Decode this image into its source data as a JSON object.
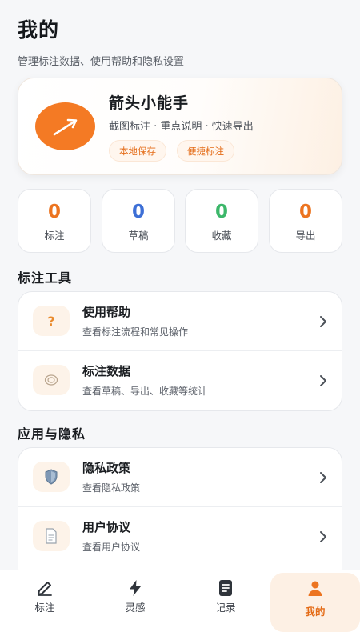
{
  "header": {
    "title": "我的",
    "subtitle": "管理标注数据、使用帮助和隐私设置"
  },
  "profile": {
    "app_name": "箭头小能手",
    "tagline": "截图标注 · 重点说明 · 快速导出",
    "tags": [
      "本地保存",
      "便捷标注"
    ],
    "logo_icon": "arrow-up-right-icon"
  },
  "stats": [
    {
      "value": "0",
      "label": "标注",
      "color": "#ec7420"
    },
    {
      "value": "0",
      "label": "草稿",
      "color": "#3d6fd6"
    },
    {
      "value": "0",
      "label": "收藏",
      "color": "#3cb76a"
    },
    {
      "value": "0",
      "label": "导出",
      "color": "#ec7420"
    }
  ],
  "tools": {
    "section_title": "标注工具",
    "items": [
      {
        "title": "使用帮助",
        "desc": "查看标注流程和常见操作",
        "icon": "question-icon"
      },
      {
        "title": "标注数据",
        "desc": "查看草稿、导出、收藏等统计",
        "icon": "target-icon"
      }
    ]
  },
  "privacy": {
    "section_title": "应用与隐私",
    "items": [
      {
        "title": "隐私政策",
        "desc": "查看隐私政策",
        "icon": "shield-icon"
      },
      {
        "title": "用户协议",
        "desc": "查看用户协议",
        "icon": "document-icon"
      }
    ]
  },
  "nav": {
    "items": [
      {
        "label": "标注",
        "icon": "pen-icon"
      },
      {
        "label": "灵感",
        "icon": "lightning-icon"
      },
      {
        "label": "记录",
        "icon": "list-icon"
      },
      {
        "label": "我的",
        "icon": "person-icon",
        "active": true
      }
    ]
  },
  "accent_color": "#ec7420"
}
